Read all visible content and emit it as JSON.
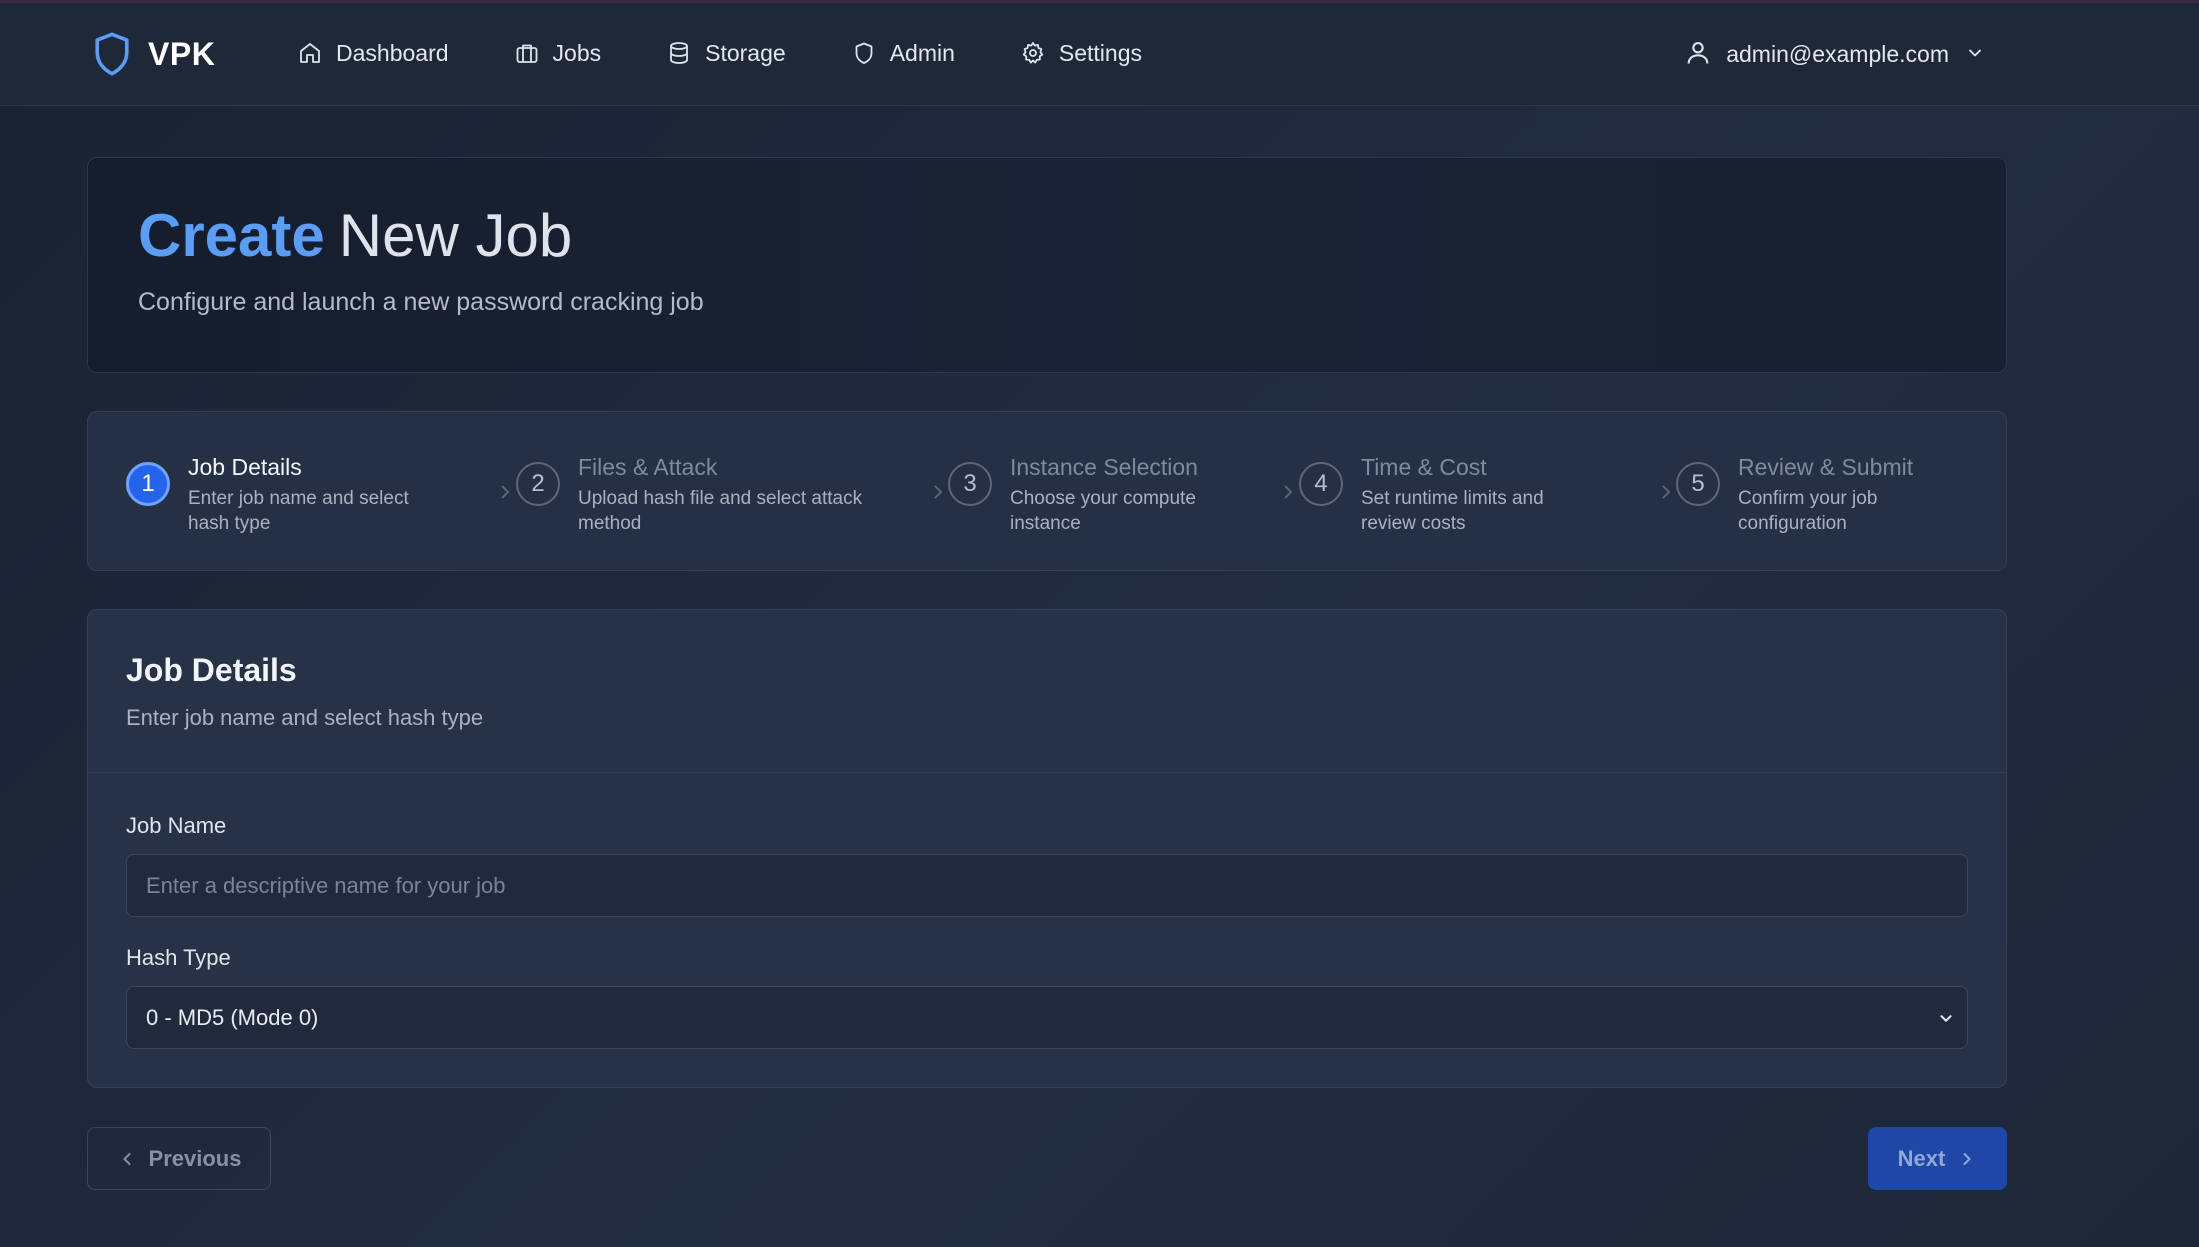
{
  "navbar": {
    "brand": "VPK",
    "links": [
      {
        "label": "Dashboard",
        "icon": "home-icon"
      },
      {
        "label": "Jobs",
        "icon": "briefcase-icon"
      },
      {
        "label": "Storage",
        "icon": "database-icon"
      },
      {
        "label": "Admin",
        "icon": "shield-icon"
      },
      {
        "label": "Settings",
        "icon": "gear-icon"
      }
    ],
    "user": "admin@example.com"
  },
  "hero": {
    "title_accent": "Create",
    "title_rest": "New Job",
    "subtitle": "Configure and launch a new password cracking job"
  },
  "stepper": {
    "active_step": 1,
    "steps": [
      {
        "num": "1",
        "title": "Job Details",
        "desc_line1": "Enter job name and select",
        "desc_line2": "hash type"
      },
      {
        "num": "2",
        "title": "Files & Attack",
        "desc_line1": "Upload hash file and select attack",
        "desc_line2": "method"
      },
      {
        "num": "3",
        "title": "Instance Selection",
        "desc_line1": "Choose your compute",
        "desc_line2": "instance"
      },
      {
        "num": "4",
        "title": "Time & Cost",
        "desc_line1": "Set runtime limits and",
        "desc_line2": "review costs"
      },
      {
        "num": "5",
        "title": "Review & Submit",
        "desc_line1": "Confirm your job",
        "desc_line2": "configuration"
      }
    ]
  },
  "form": {
    "title": "Job Details",
    "subtitle": "Enter job name and select hash type",
    "job_name_label": "Job Name",
    "job_name_value": "",
    "job_name_placeholder": "Enter a descriptive name for your job",
    "hash_type_label": "Hash Type",
    "hash_type_value": "0 - MD5 (Mode 0)"
  },
  "buttons": {
    "previous": "Previous",
    "next": "Next"
  },
  "colors": {
    "accent": "#5b9cf5",
    "active_step": "#2563eb",
    "next_button": "#1f47a8"
  }
}
